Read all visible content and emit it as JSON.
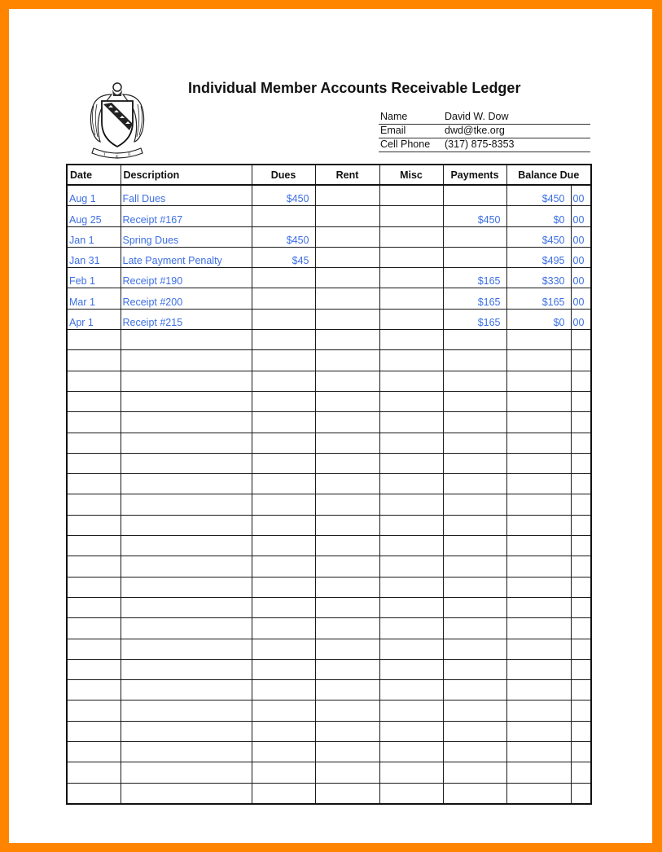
{
  "header": {
    "logo": "fraternity-crest",
    "title": "Individual Member Accounts Receivable Ledger"
  },
  "member_info": [
    {
      "label": "Name",
      "value": "David W. Dow"
    },
    {
      "label": "Email",
      "value": "dwd@tke.org"
    },
    {
      "label": "Cell Phone",
      "value": "(317) 875-8353"
    }
  ],
  "ledger": {
    "columns": [
      "Date",
      "Description",
      "Dues",
      "Rent",
      "Misc",
      "Payments",
      "Balance Due"
    ],
    "rows": [
      {
        "date": "Aug 1",
        "description": "Fall Dues",
        "dues": "$450",
        "rent": "",
        "misc": "",
        "payments": "",
        "balance": "$450",
        "cents": "00"
      },
      {
        "date": "Aug 25",
        "description": "Receipt #167",
        "dues": "",
        "rent": "",
        "misc": "",
        "payments": "$450",
        "balance": "$0",
        "cents": "00"
      },
      {
        "date": "Jan 1",
        "description": "Spring Dues",
        "dues": "$450",
        "rent": "",
        "misc": "",
        "payments": "",
        "balance": "$450",
        "cents": "00"
      },
      {
        "date": "Jan 31",
        "description": "Late Payment Penalty",
        "dues": "$45",
        "rent": "",
        "misc": "",
        "payments": "",
        "balance": "$495",
        "cents": "00"
      },
      {
        "date": "Feb 1",
        "description": "Receipt #190",
        "dues": "",
        "rent": "",
        "misc": "",
        "payments": "$165",
        "balance": "$330",
        "cents": "00"
      },
      {
        "date": "Mar 1",
        "description": "Receipt #200",
        "dues": "",
        "rent": "",
        "misc": "",
        "payments": "$165",
        "balance": "$165",
        "cents": "00"
      },
      {
        "date": "Apr 1",
        "description": "Receipt #215",
        "dues": "",
        "rent": "",
        "misc": "",
        "payments": "$165",
        "balance": "$0",
        "cents": "00"
      }
    ],
    "empty_row_count": 23
  },
  "colors": {
    "frame": "#FF8400",
    "entry_text": "#3D6FE3"
  }
}
